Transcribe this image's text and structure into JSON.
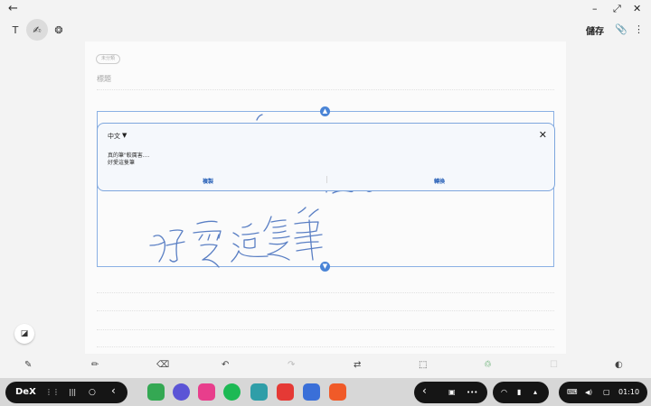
{
  "titlebar": {
    "back_icon": "←",
    "minimize_icon": "–",
    "maximize_icon": "⤢",
    "close_icon": "✕"
  },
  "toolbar": {
    "text_tool": "T",
    "pen_tool": "✍",
    "brush_tool": "❂",
    "save_label": "儲存",
    "attach_icon": "📎",
    "more_icon": "⋮"
  },
  "note": {
    "tag_label": "未分類",
    "title_placeholder": "標題"
  },
  "recognition": {
    "language": "中文",
    "language_arrow": "▼",
    "close": "✕",
    "line1": "真的筆\"較厲害....",
    "line2": "好愛這隻筆",
    "copy_label": "複製",
    "convert_label": "轉換"
  },
  "bottomtools": {
    "pen": "✎",
    "highlighter": "✏",
    "eraser": "⌫",
    "undo": "↶",
    "redo": "↷",
    "convert_text": "⇄",
    "select": "⬚",
    "shape": "♲",
    "checkbox": "☐",
    "color": "◐"
  },
  "taskbar": {
    "dex_label": "DeX",
    "apps_icon": "⋮⋮",
    "recents_icon": "|||",
    "home_icon": "○",
    "back_icon": "‹",
    "nav_back": "‹",
    "gallery_icon": "▣",
    "more_icon": "•••",
    "wifi_icon": "◠",
    "battery_icon": "▮",
    "up_icon": "▴",
    "keyboard_icon": "⌨",
    "volume_icon": "◀)",
    "screen_icon": "▢",
    "time": "01:10",
    "app_colors": [
      "#34a853",
      "#5b54d6",
      "#e83e8c",
      "#1db954",
      "#2f9ea8",
      "#e53935",
      "#3a6fd8",
      "#f05a28"
    ]
  }
}
